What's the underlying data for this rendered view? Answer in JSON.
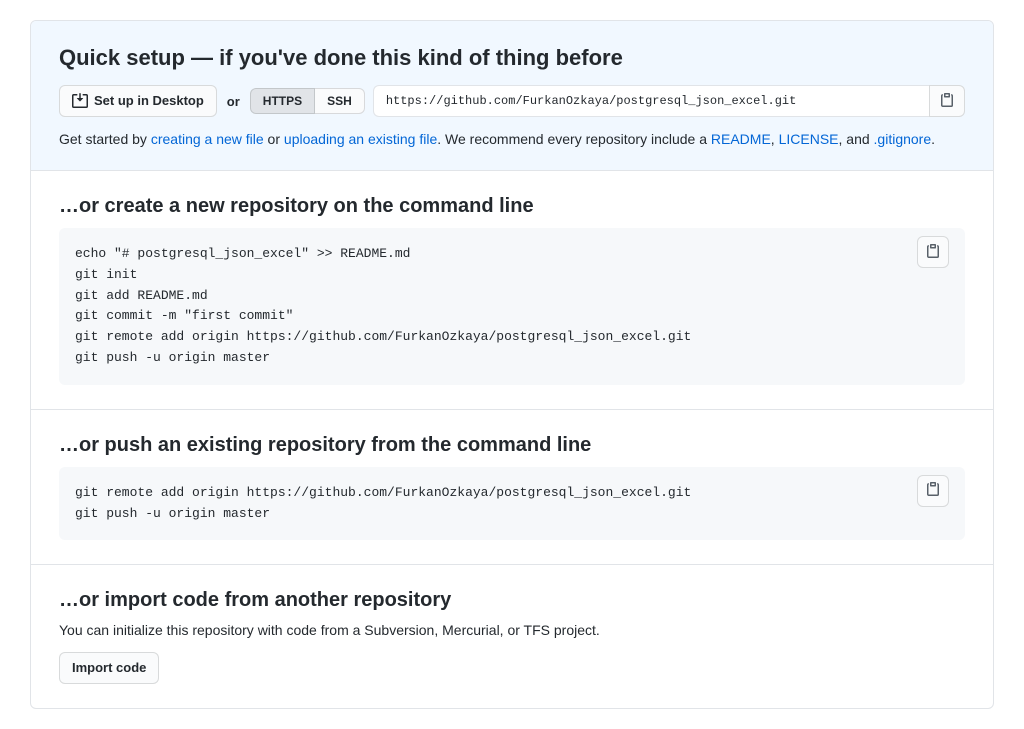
{
  "quickSetup": {
    "title": "Quick setup — if you've done this kind of thing before",
    "desktopBtn": "Set up in Desktop",
    "orText": "or",
    "httpsTab": "HTTPS",
    "sshTab": "SSH",
    "cloneUrl": "https://github.com/FurkanOzkaya/postgresql_json_excel.git",
    "helpPrefix": "Get started by ",
    "linkNewFile": "creating a new file",
    "helpOr": " or ",
    "linkUpload": "uploading an existing file",
    "helpMid": ". We recommend every repository include a ",
    "linkReadme": "README",
    "commaSep": ", ",
    "linkLicense": "LICENSE",
    "andSep": ", and ",
    "linkGitignore": ".gitignore",
    "helpEnd": "."
  },
  "createRepo": {
    "title": "…or create a new repository on the command line",
    "code": "echo \"# postgresql_json_excel\" >> README.md\ngit init\ngit add README.md\ngit commit -m \"first commit\"\ngit remote add origin https://github.com/FurkanOzkaya/postgresql_json_excel.git\ngit push -u origin master"
  },
  "pushRepo": {
    "title": "…or push an existing repository from the command line",
    "code": "git remote add origin https://github.com/FurkanOzkaya/postgresql_json_excel.git\ngit push -u origin master"
  },
  "importRepo": {
    "title": "…or import code from another repository",
    "desc": "You can initialize this repository with code from a Subversion, Mercurial, or TFS project.",
    "btn": "Import code"
  }
}
